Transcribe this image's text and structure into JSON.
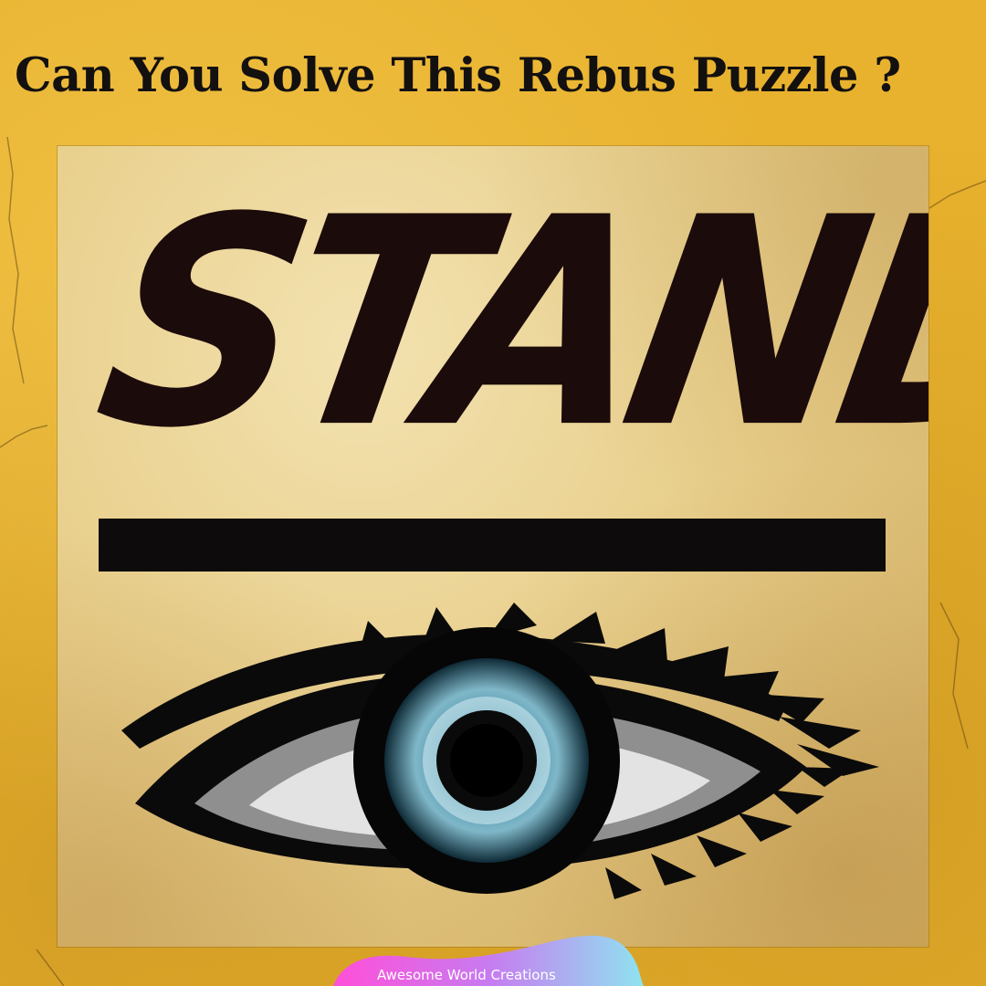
{
  "title": "Can You Solve This Rebus Puzzle ?",
  "puzzle": {
    "word": "STAND",
    "image": "eye-illustration"
  },
  "watermark": {
    "text": "Awesome World Creations"
  },
  "colors": {
    "background": "#e8b22e",
    "panel": "#ecd497",
    "ink": "#1c0b0b",
    "iris": "#3f8aa4"
  }
}
